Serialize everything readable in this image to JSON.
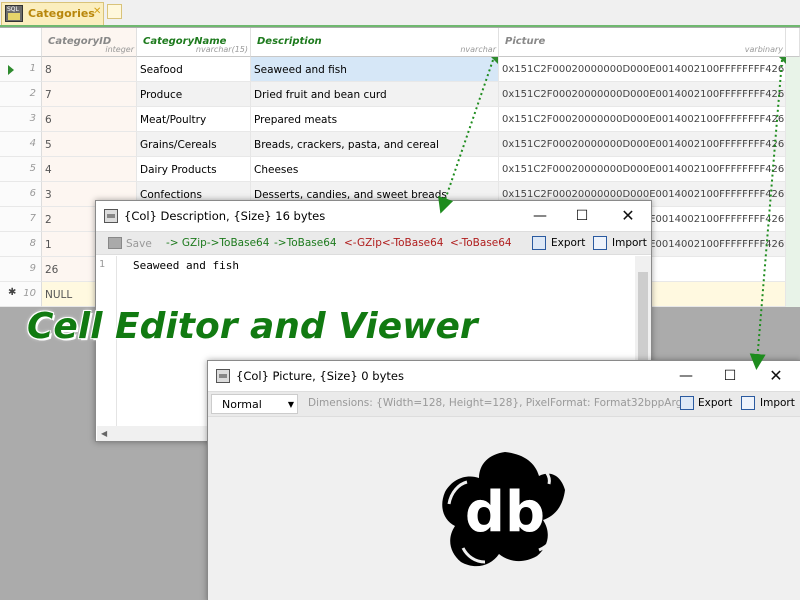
{
  "tab": {
    "label": "Categories"
  },
  "columns": [
    {
      "name": "CategoryID",
      "type": "integer"
    },
    {
      "name": "CategoryName",
      "type": "nvarchar(15)"
    },
    {
      "name": "Description",
      "type": "nvarchar"
    },
    {
      "name": "Picture",
      "type": "varbinary"
    }
  ],
  "rows": [
    {
      "num": "1",
      "id": "8",
      "name": "Seafood",
      "desc": "Seaweed and fish",
      "pic": "0x151C2F00020000000D000E0014002100FFFFFFFF4269..."
    },
    {
      "num": "2",
      "id": "7",
      "name": "Produce",
      "desc": "Dried fruit and bean curd",
      "pic": "0x151C2F00020000000D000E0014002100FFFFFFFF4269..."
    },
    {
      "num": "3",
      "id": "6",
      "name": "Meat/Poultry",
      "desc": "Prepared meats",
      "pic": "0x151C2F00020000000D000E0014002100FFFFFFFF4269..."
    },
    {
      "num": "4",
      "id": "5",
      "name": "Grains/Cereals",
      "desc": "Breads, crackers, pasta, and cereal",
      "pic": "0x151C2F00020000000D000E0014002100FFFFFFFF4269..."
    },
    {
      "num": "5",
      "id": "4",
      "name": "Dairy Products",
      "desc": "Cheeses",
      "pic": "0x151C2F00020000000D000E0014002100FFFFFFFF4269..."
    },
    {
      "num": "6",
      "id": "3",
      "name": "Confections",
      "desc": "Desserts, candies, and sweet breads",
      "pic": "0x151C2F00020000000D000E0014002100FFFFFFFF4269..."
    },
    {
      "num": "7",
      "id": "2",
      "name": "",
      "desc": "",
      "pic": "0x151C2F00020000000D000E0014002100FFFFFFFF4269..."
    },
    {
      "num": "8",
      "id": "1",
      "name": "",
      "desc": "",
      "pic": "0x151C2F00020000000D000E0014002100FFFFFFFF4269..."
    },
    {
      "num": "9",
      "id": "26",
      "name": "",
      "desc": "",
      "pic": ""
    }
  ],
  "new_row": {
    "num": "10",
    "id": "NULL"
  },
  "overlay_title": "Cell Editor and Viewer",
  "desc_window": {
    "title": "{Col} Description, {Size} 16 bytes",
    "toolbar": {
      "save": "Save",
      "gzip_to_base64": "-> GZip->ToBase64",
      "to_base64": "->ToBase64",
      "from_gzip_base64": "<-GZip<-ToBase64",
      "from_base64": "<-ToBase64",
      "export": "Export",
      "import": "Import"
    },
    "line_number": "1",
    "content": "Seaweed and fish"
  },
  "pic_window": {
    "title": "{Col} Picture, {Size} 0 bytes",
    "mode": "Normal",
    "dimensions": "Dimensions: {Width=128, Height=128}, PixelFormat: Format32bppArgb",
    "export": "Export",
    "import": "Import",
    "logo_text": "db"
  },
  "icons": {
    "tab": "sql-table-icon",
    "current_row": "row-indicator-icon",
    "new_row": "new-row-star-icon",
    "minimize": "minimize-icon",
    "maximize": "maximize-icon",
    "close": "close-icon",
    "save": "save-icon",
    "export": "export-icon",
    "import": "import-icon",
    "dropdown": "chevron-down-icon"
  },
  "colors": {
    "accent_green": "#117a11",
    "tab_bg": "#fbeebe",
    "selected_cell": "#d6e7f7",
    "red_action": "#b01d1d"
  }
}
